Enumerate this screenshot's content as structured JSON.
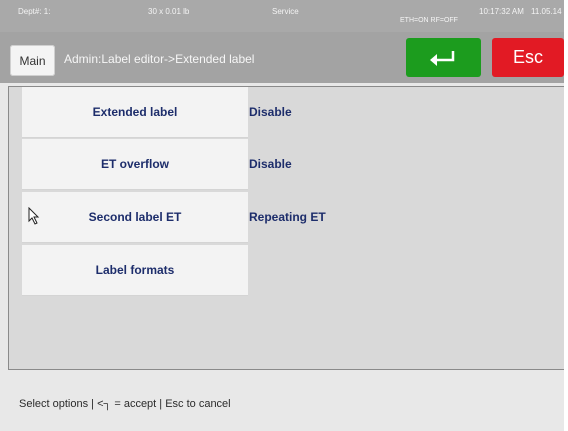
{
  "status": {
    "dept": "Dept#: 1:",
    "weight": "30 x 0.01 lb",
    "mode": "Service",
    "time": "10:17:32 AM",
    "date": "11.05.14",
    "network": "ETH=ON  RF=OFF"
  },
  "titlebar": {
    "main_label": "Main",
    "breadcrumb": "Admin:Label editor->Extended label",
    "enter_icon": "enter-arrow-icon",
    "esc_label": "Esc",
    "enter_color": "#1c9c1e",
    "esc_color": "#e21a24"
  },
  "options": [
    {
      "label": "Extended label",
      "value": "Disable"
    },
    {
      "label": "ET overflow",
      "value": "Disable"
    },
    {
      "label": "Second label ET",
      "value": "Repeating ET"
    },
    {
      "label": "Label formats",
      "value": ""
    }
  ],
  "footer": {
    "hint": "Select options | <┐ = accept | Esc to cancel"
  }
}
